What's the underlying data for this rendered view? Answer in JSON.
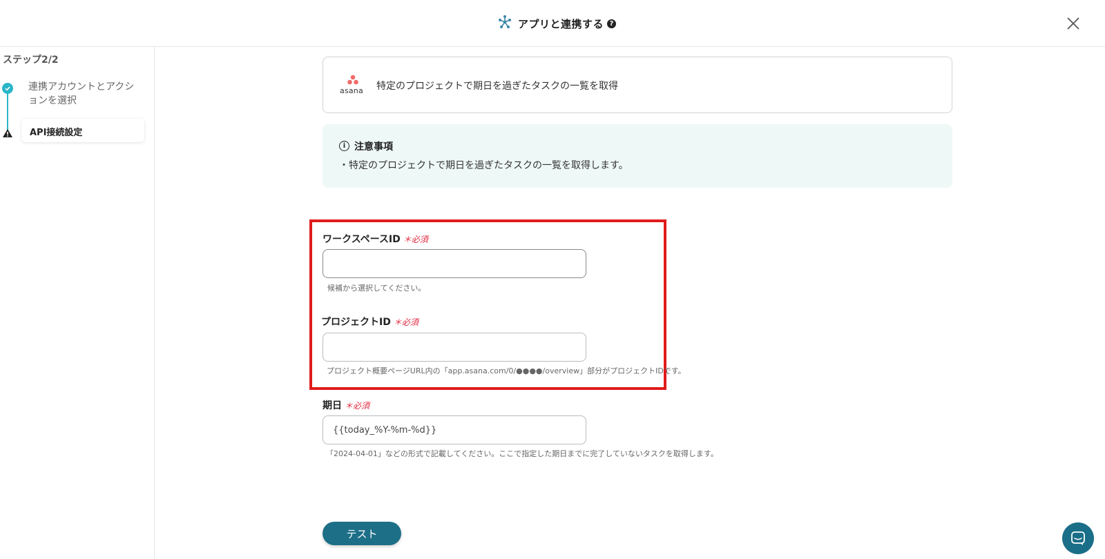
{
  "header": {
    "title": "アプリと連携する",
    "help": "?"
  },
  "sidebar": {
    "step_label": "ステップ2/2",
    "steps": [
      {
        "label": "連携アカウントとアクションを選択",
        "status": "done"
      },
      {
        "label": "API接続設定",
        "status": "warning"
      }
    ]
  },
  "app_card": {
    "logo_text": "asana",
    "action_text": "特定のプロジェクトで期日を過ぎたタスクの一覧を取得"
  },
  "notice": {
    "icon": "i",
    "title": "注意事項",
    "body": "・特定のプロジェクトで期日を過ぎたタスクの一覧を取得します。"
  },
  "form": {
    "required_label": "必須",
    "fields": [
      {
        "label": "ワークスペースID",
        "value": "",
        "hint": "候補から選択してください。"
      },
      {
        "label": "プロジェクトID",
        "value": "",
        "hint": "プロジェクト概要ページURL内の「app.asana.com/0/●●●●/overview」部分がプロジェクトIDです。"
      },
      {
        "label": "期日",
        "value": "{{today_%Y-%m-%d}}",
        "hint": "「2024-04-01」などの形式で記載してください。ここで指定した期日までに完了していないタスクを取得します。"
      }
    ]
  },
  "actions": {
    "test_label": "テスト"
  },
  "colors": {
    "accent": "#1d6f87",
    "step_done": "#29b6c8",
    "required": "#e0263c",
    "highlight": "#e01b1b",
    "notice_bg": "#eef8f7"
  }
}
